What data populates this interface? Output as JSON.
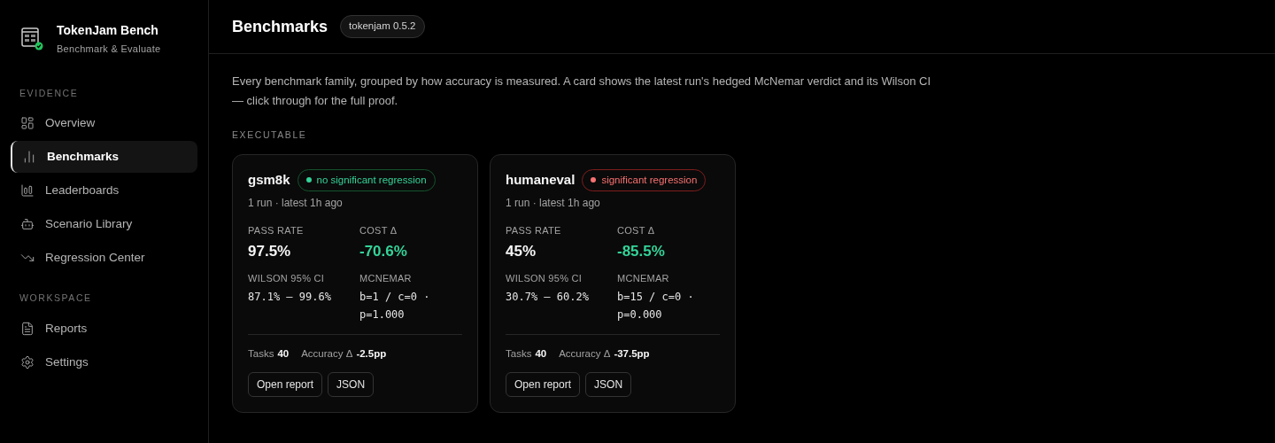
{
  "app": {
    "name": "TokenJam Bench",
    "subtitle": "Benchmark & Evaluate"
  },
  "sidebar": {
    "sections": [
      {
        "title": "EVIDENCE",
        "items": [
          {
            "label": "Overview",
            "selected": false
          },
          {
            "label": "Benchmarks",
            "selected": true
          },
          {
            "label": "Leaderboards",
            "selected": false
          },
          {
            "label": "Scenario Library",
            "selected": false
          },
          {
            "label": "Regression Center",
            "selected": false
          }
        ]
      },
      {
        "title": "WORKSPACE",
        "items": [
          {
            "label": "Reports",
            "selected": false
          },
          {
            "label": "Settings",
            "selected": false
          }
        ]
      }
    ]
  },
  "header": {
    "title": "Benchmarks",
    "version": "tokenjam 0.5.2"
  },
  "intro": "Every benchmark family, grouped by how accuracy is measured. A card shows the latest run's hedged McNemar verdict and its Wilson CI — click through for the full proof.",
  "group": {
    "title": "EXECUTABLE",
    "cards": [
      {
        "name": "gsm8k",
        "verdict": {
          "kind": "ok",
          "label": "no significant regression"
        },
        "meta": "1 run · latest 1h ago",
        "pass_label": "PASS RATE",
        "pass_rate": "97.5%",
        "cost_label": "COST Δ",
        "cost": "-70.6%",
        "ci_label": "WILSON 95% CI",
        "ci": "87.1% — 99.6%",
        "mcnemar_label": "MCNEMAR",
        "mcnemar": "b=1 / c=0 · p=1.000",
        "tasks_label": "Tasks",
        "tasks": "40",
        "acc_label": "Accuracy Δ",
        "acc": "-2.5pp",
        "buttons": [
          "Open report",
          "JSON"
        ]
      },
      {
        "name": "humaneval",
        "verdict": {
          "kind": "regression",
          "label": "significant regression"
        },
        "meta": "1 run · latest 1h ago",
        "pass_label": "PASS RATE",
        "pass_rate": "45%",
        "cost_label": "COST Δ",
        "cost": "-85.5%",
        "ci_label": "WILSON 95% CI",
        "ci": "30.7% — 60.2%",
        "mcnemar_label": "MCNEMAR",
        "mcnemar": "b=15 / c=0 · p=0.000",
        "tasks_label": "Tasks",
        "tasks": "40",
        "acc_label": "Accuracy Δ",
        "acc": "-37.5pp",
        "buttons": [
          "Open report",
          "JSON"
        ]
      }
    ]
  }
}
